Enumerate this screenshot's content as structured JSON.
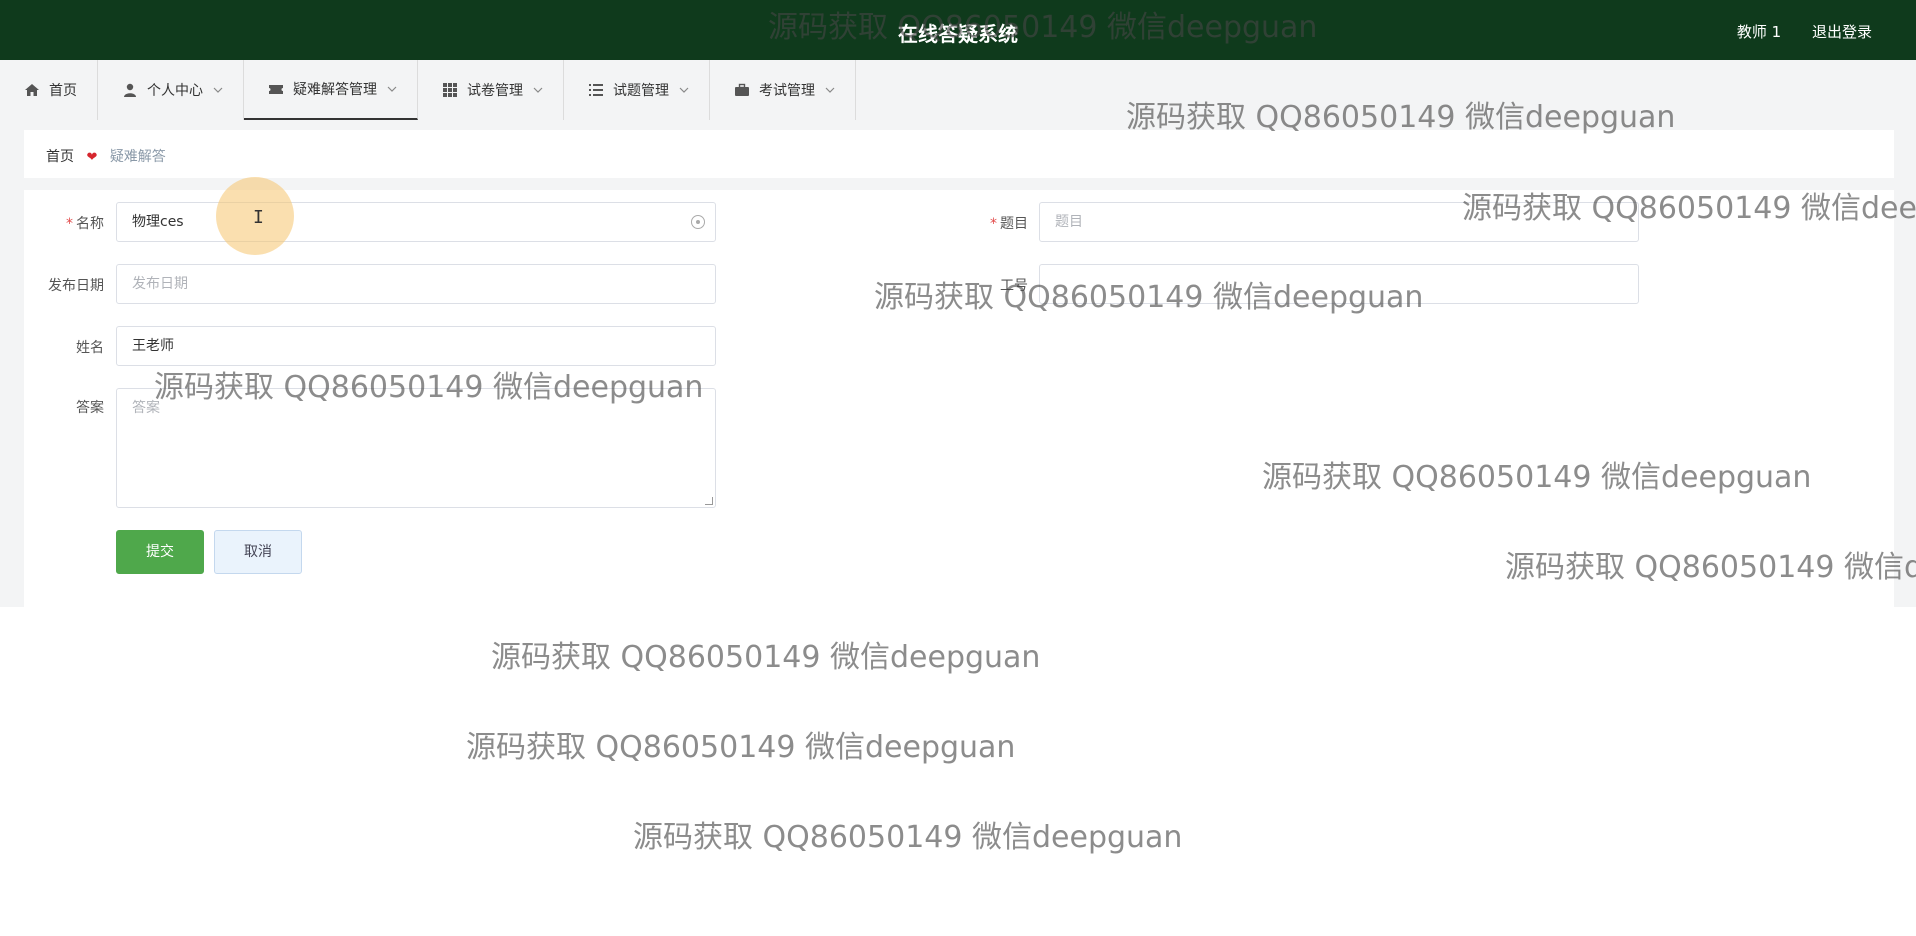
{
  "header": {
    "title": "在线答疑系统",
    "user": "教师 1",
    "logout": "退出登录"
  },
  "nav": [
    {
      "label": "首页",
      "icon": "home-icon",
      "has_menu": false
    },
    {
      "label": "个人中心",
      "icon": "user-icon",
      "has_menu": true
    },
    {
      "label": "疑难解答管理",
      "icon": "ticket-icon",
      "has_menu": true,
      "active": true
    },
    {
      "label": "试卷管理",
      "icon": "grid-icon",
      "has_menu": true
    },
    {
      "label": "试题管理",
      "icon": "list-icon",
      "has_menu": true
    },
    {
      "label": "考试管理",
      "icon": "briefcase-icon",
      "has_menu": true
    }
  ],
  "breadcrumb": {
    "home": "首页",
    "current": "疑难解答"
  },
  "form": {
    "name_label": "名称",
    "name_value": "物理ces",
    "topic_label": "题目",
    "topic_placeholder": "题目",
    "date_label": "发布日期",
    "date_placeholder": "发布日期",
    "teacher_label": "工号",
    "teacher_value": "",
    "person_label": "姓名",
    "person_value": "王老师",
    "answer_label": "答案",
    "answer_placeholder": "答案",
    "submit": "提交",
    "cancel": "取消"
  },
  "watermark": "源码获取 QQ86050149 微信deepguan",
  "colors": {
    "header_bg": "#0f3a1c",
    "submit_bg": "#4fa84b",
    "required": "#e24a4a"
  }
}
